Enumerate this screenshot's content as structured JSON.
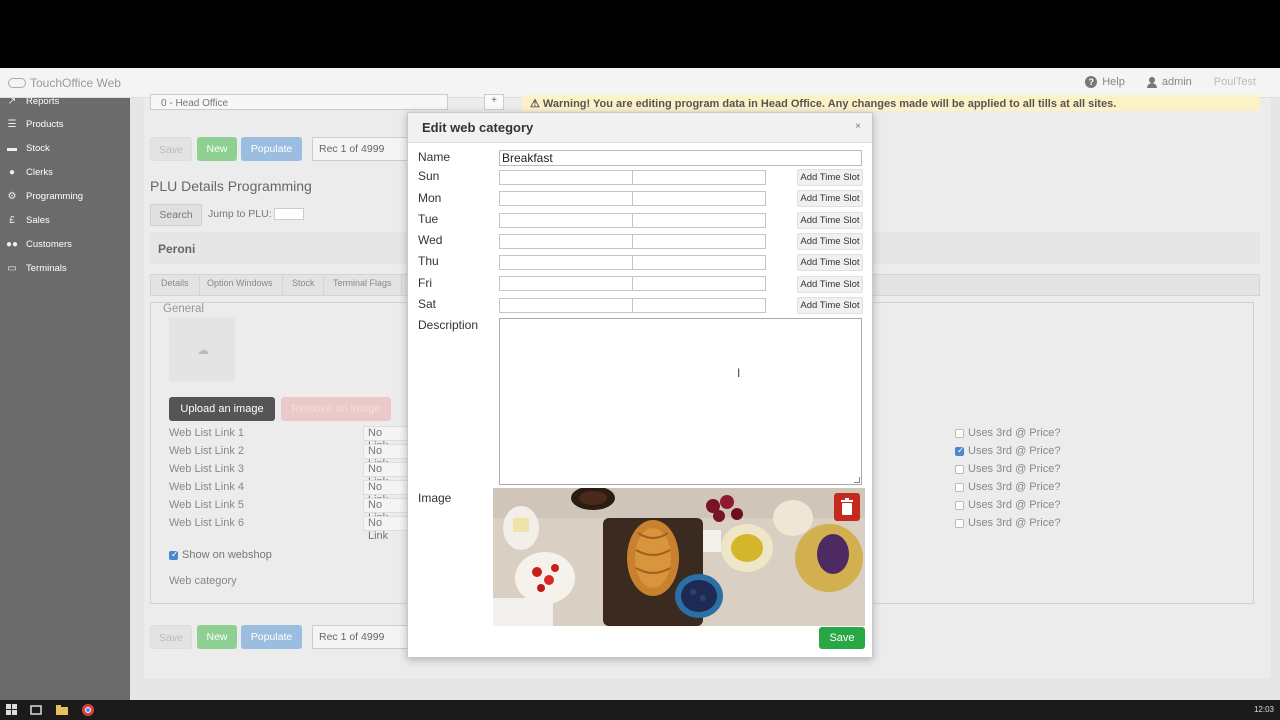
{
  "app": {
    "brand": "TouchOffice Web",
    "help": "Help",
    "user": "admin",
    "tenant": "PoulTest"
  },
  "sidebar": {
    "items": [
      {
        "label": "Reports",
        "icon": "chart-line-icon"
      },
      {
        "label": "Products",
        "icon": "list-icon"
      },
      {
        "label": "Stock",
        "icon": "truck-icon"
      },
      {
        "label": "Clerks",
        "icon": "person-icon"
      },
      {
        "label": "Programming",
        "icon": "gear-icon"
      },
      {
        "label": "Sales",
        "icon": "pound-icon"
      },
      {
        "label": "Customers",
        "icon": "users-icon"
      },
      {
        "label": "Terminals",
        "icon": "monitor-icon"
      }
    ]
  },
  "page": {
    "site_select": "0 - Head Office",
    "plus": "+",
    "warning": "⚠ Warning! You are editing program data in Head Office. Any changes made will be applied to all tills at all sites.",
    "toolbar": {
      "save": "Save",
      "new": "New",
      "populate": "Populate",
      "rec": "Rec 1 of 4999"
    },
    "title": "PLU Details Programming",
    "search": "Search",
    "jump_label": "Jump to PLU:",
    "product_name": "Peroni",
    "tabs": [
      "Details",
      "Option Windows",
      "Stock",
      "Terminal Flags"
    ],
    "general_title": "General",
    "upload": "Upload an image",
    "remove": "Remove an image",
    "web_links": [
      {
        "label": "Web List Link 1",
        "value": "No Link",
        "uses": "Uses 3rd @ Price?",
        "checked": false
      },
      {
        "label": "Web List Link 2",
        "value": "No Link",
        "uses": "Uses 3rd @ Price?",
        "checked": true
      },
      {
        "label": "Web List Link 3",
        "value": "No Link",
        "uses": "Uses 3rd @ Price?",
        "checked": false
      },
      {
        "label": "Web List Link 4",
        "value": "No Link",
        "uses": "Uses 3rd @ Price?",
        "checked": false
      },
      {
        "label": "Web List Link 5",
        "value": "No Link",
        "uses": "Uses 3rd @ Price?",
        "checked": false
      },
      {
        "label": "Web List Link 6",
        "value": "No Link",
        "uses": "Uses 3rd @ Price?",
        "checked": false
      }
    ],
    "show_on_webshop": "Show on webshop",
    "web_category": "Web category"
  },
  "modal": {
    "title": "Edit web category",
    "close": "×",
    "name_label": "Name",
    "name_value": "Breakfast",
    "days": [
      "Sun",
      "Mon",
      "Tue",
      "Wed",
      "Thu",
      "Fri",
      "Sat"
    ],
    "add_time_slot": "Add Time Slot",
    "description_label": "Description",
    "image_label": "Image",
    "save": "Save"
  },
  "taskbar": {
    "time": "12:03"
  }
}
